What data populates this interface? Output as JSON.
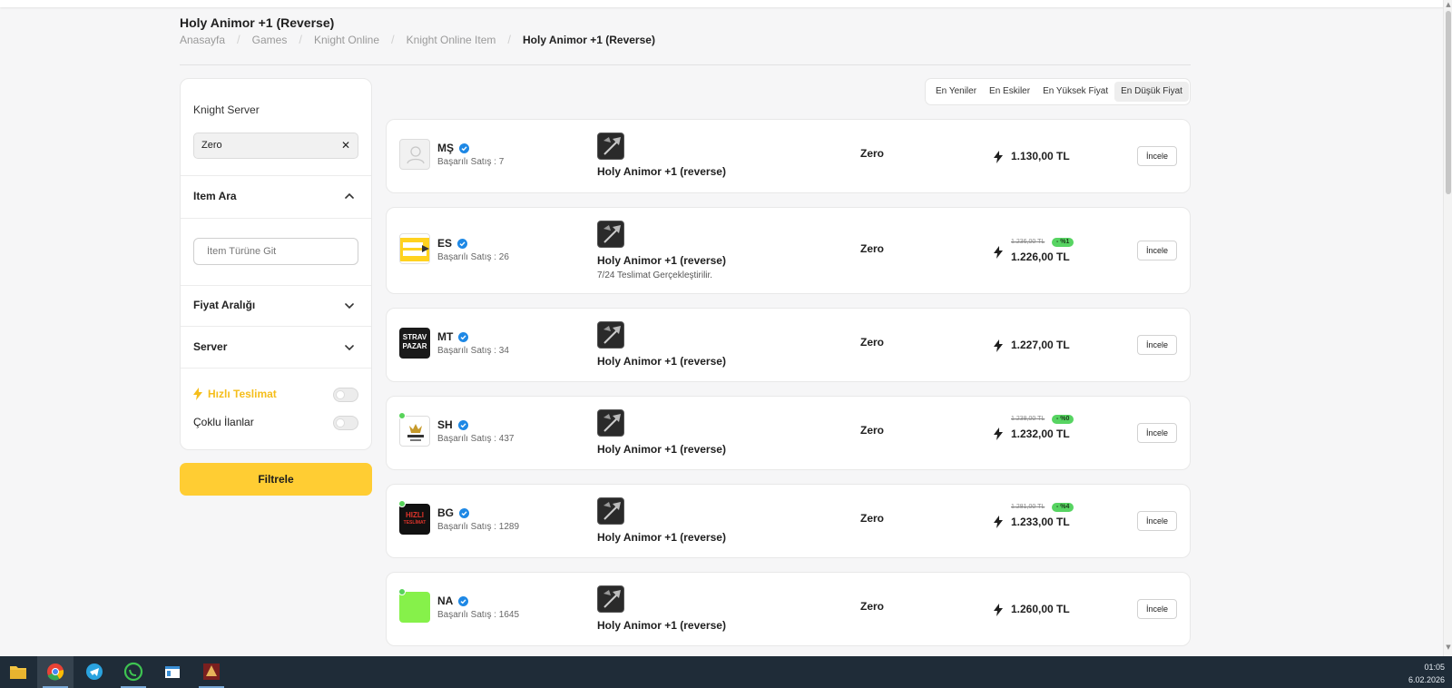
{
  "page": {
    "title": "Holy Animor +1 (Reverse)",
    "breadcrumb": [
      "Anasayfa",
      "Games",
      "Knight Online",
      "Knight Online Item",
      "Holy Animor +1 (Reverse)"
    ]
  },
  "sidebar": {
    "server_label": "Knight Server",
    "server_value": "Zero",
    "item_search_title": "Item Ara",
    "item_search_placeholder": "İtem Türüne Git",
    "price_range_title": "Fiyat Aralığı",
    "server_title": "Server",
    "fast_delivery_label": "Hızlı Teslimat",
    "multi_listings_label": "Çoklu İlanlar",
    "filter_button": "Filtrele"
  },
  "sort": {
    "options": [
      "En Yeniler",
      "En Eskiler",
      "En Yüksek Fiyat",
      "En Düşük Fiyat"
    ],
    "active": "En Düşük Fiyat"
  },
  "listings": [
    {
      "seller": "MŞ",
      "sales": "Başarılı Satış : 7",
      "item": "Holy Animor +1 (reverse)",
      "note": "",
      "server": "Zero",
      "price": "1.130,00 TL",
      "old_price": "",
      "discount": "",
      "button": "İncele",
      "online": false,
      "avatar": "placeholder"
    },
    {
      "seller": "ES",
      "sales": "Başarılı Satış : 26",
      "item": "Holy Animor +1 (reverse)",
      "note": "7/24 Teslimat Gerçekleştirilir.",
      "server": "Zero",
      "price": "1.226,00 TL",
      "old_price": "1.236,00 TL",
      "discount": "- %1",
      "button": "İncele",
      "online": false,
      "avatar": "kargo-logo"
    },
    {
      "seller": "MT",
      "sales": "Başarılı Satış : 34",
      "item": "Holy Animor +1 (reverse)",
      "note": "",
      "server": "Zero",
      "price": "1.227,00 TL",
      "old_price": "",
      "discount": "",
      "button": "İncele",
      "online": false,
      "avatar": "strav-pazar-logo",
      "avatar_text": [
        "STRAV",
        "PAZAR"
      ]
    },
    {
      "seller": "SH",
      "sales": "Başarılı Satış : 437",
      "item": "Holy Animor +1 (reverse)",
      "note": "",
      "server": "Zero",
      "price": "1.232,00 TL",
      "old_price": "1.238,00 TL",
      "discount": "- %0",
      "button": "İncele",
      "online": true,
      "avatar": "balkan-logo"
    },
    {
      "seller": "BG",
      "sales": "Başarılı Satış : 1289",
      "item": "Holy Animor +1 (reverse)",
      "note": "",
      "server": "Zero",
      "price": "1.233,00 TL",
      "old_price": "1.281,00 TL",
      "discount": "- %4",
      "button": "İncele",
      "online": true,
      "avatar": "hizli-teslimat-logo",
      "avatar_text": [
        "HIZLI",
        "TESLİMAT"
      ]
    },
    {
      "seller": "NA",
      "sales": "Başarılı Satış : 1645",
      "item": "Holy Animor +1 (reverse)",
      "note": "",
      "server": "Zero",
      "price": "1.260,00 TL",
      "old_price": "",
      "discount": "",
      "button": "İncele",
      "online": true,
      "avatar": "green-square"
    }
  ],
  "taskbar": {
    "apps": [
      "file-explorer-icon",
      "chrome-icon",
      "telegram-icon",
      "whatsapp-icon",
      "window-app-icon",
      "game-icon"
    ],
    "time": "01:05",
    "date": "6.02.2026"
  },
  "colors": {
    "accent": "#ffcd33",
    "discount": "#57d462",
    "verified": "#1e88e5",
    "taskbar": "#1f2c38"
  }
}
